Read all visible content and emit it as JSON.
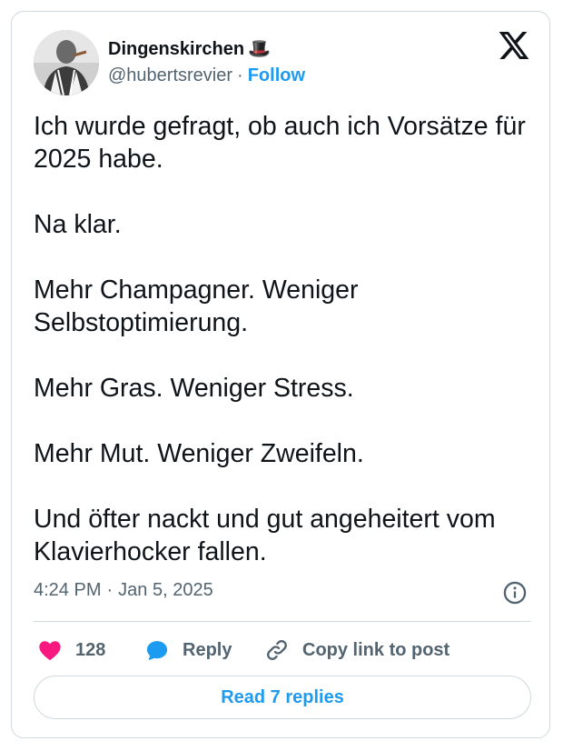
{
  "author": {
    "display_name": "Dingenskirchen",
    "emoji": "🎩",
    "handle": "@hubertsrevier",
    "separator": "·",
    "follow_label": "Follow"
  },
  "brand": {
    "logo_icon": "x-logo-icon"
  },
  "tweet": {
    "paragraphs": [
      "Ich wurde gefragt, ob auch ich Vorsätze für 2025 habe.",
      "Na klar.",
      "Mehr Champagner. Weniger Selbstoptimierung.",
      "Mehr Gras. Weniger Stress.",
      "Mehr Mut. Weniger Zweifeln.",
      "Und öfter nackt und gut angeheitert vom Klavierhocker fallen."
    ],
    "time": "4:24 PM",
    "separator": "·",
    "date": "Jan 5, 2025"
  },
  "actions": {
    "like_count": "128",
    "reply_label": "Reply",
    "copy_label": "Copy link to post",
    "read_replies_label": "Read 7 replies"
  },
  "colors": {
    "accent": "#1d9bf0",
    "like": "#f91880",
    "text": "#0f1419",
    "muted": "#536471",
    "border": "#cfd9de"
  }
}
